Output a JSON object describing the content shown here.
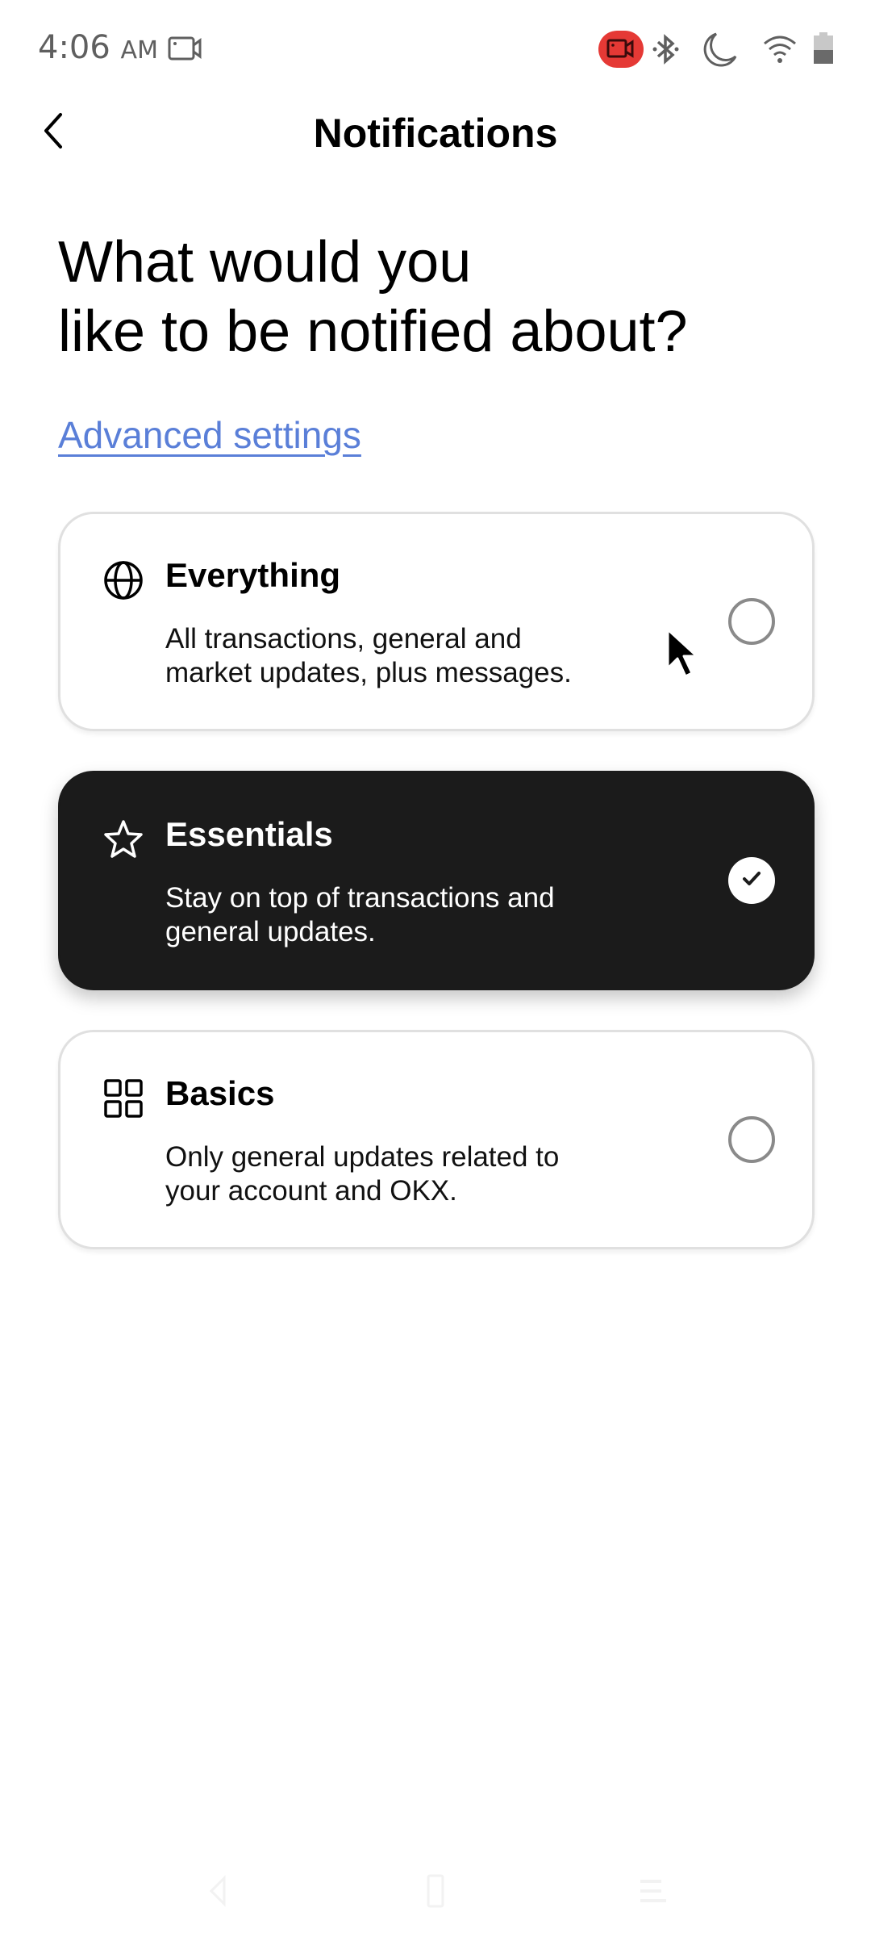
{
  "status_bar": {
    "time": "4:06",
    "ampm": "AM",
    "icons": [
      "screen-record-icon",
      "recording-active-icon",
      "bluetooth-icon",
      "do-not-disturb-icon",
      "wifi-icon",
      "battery-icon"
    ],
    "record_color": "#e53935"
  },
  "app_bar": {
    "title": "Notifications",
    "back_icon": "chevron-left-icon"
  },
  "main": {
    "headline_line1": "What would you",
    "headline_line2": "like to be notified about?",
    "advanced_link": "Advanced settings",
    "link_color": "#5a7fd8",
    "options": [
      {
        "icon": "globe-icon",
        "title": "Everything",
        "description_line1": "All transactions, general and",
        "description_line2": "market updates, plus messages.",
        "selected": false
      },
      {
        "icon": "star-icon",
        "title": "Essentials",
        "description_line1": "Stay on top of transactions and",
        "description_line2": "general updates.",
        "selected": true
      },
      {
        "icon": "grid-icon",
        "title": "Basics",
        "description_line1": "Only general updates related to",
        "description_line2": "your account and OKX.",
        "selected": false
      }
    ],
    "selected_card_color": "#1b1b1b"
  },
  "nav_bar": {
    "buttons": [
      "back-nav-icon",
      "home-nav-icon",
      "recents-nav-icon"
    ]
  }
}
